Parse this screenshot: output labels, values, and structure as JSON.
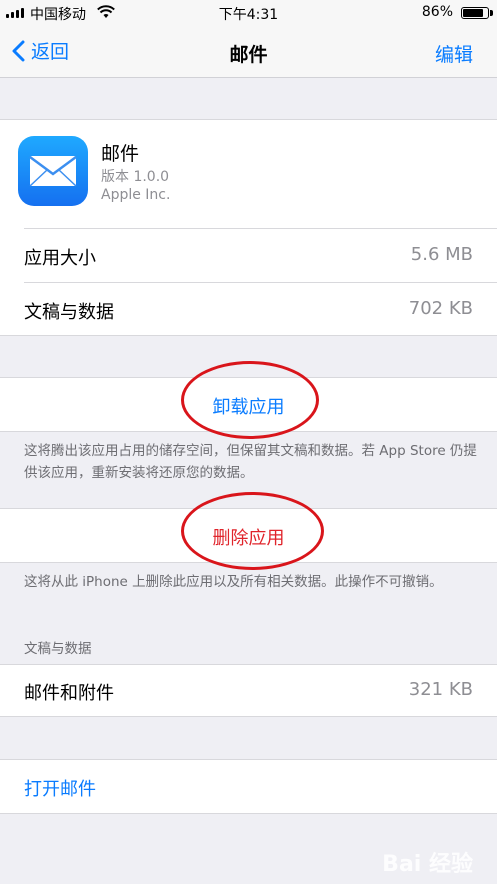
{
  "status_bar": {
    "carrier": "中国移动",
    "time": "下午4:31",
    "battery_percent": "86%",
    "battery_level": 0.86
  },
  "nav": {
    "back_label": "返回",
    "title": "邮件",
    "edit_label": "编辑"
  },
  "app": {
    "name": "邮件",
    "version": "版本 1.0.0",
    "developer": "Apple Inc."
  },
  "storage": [
    {
      "label": "应用大小",
      "value": "5.6 MB"
    },
    {
      "label": "文稿与数据",
      "value": "702 KB"
    }
  ],
  "offload": {
    "button_label": "卸载应用",
    "note": "这将腾出该应用占用的储存空间，但保留其文稿和数据。若 App Store 仍提供该应用，重新安装将还原您的数据。"
  },
  "delete": {
    "button_label": "删除应用",
    "note": "这将从此 iPhone 上删除此应用以及所有相关数据。此操作不可撤销。"
  },
  "documents": {
    "header": "文稿与数据",
    "row_label": "邮件和附件",
    "row_value": "321 KB"
  },
  "open": {
    "label": "打开邮件"
  },
  "colors": {
    "accent": "#0a7cff",
    "destructive": "#e0242b",
    "annotation": "#d9151b"
  },
  "watermark": "Bai 经验"
}
